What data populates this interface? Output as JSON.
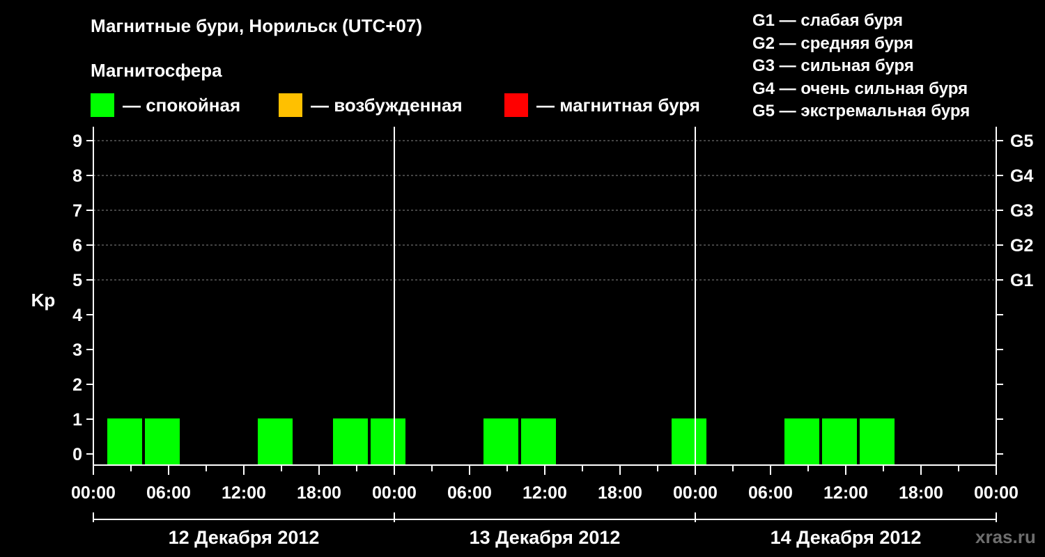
{
  "header": {
    "title": "Магнитные бури, Норильск (UTC+07)",
    "subtitle": "Магнитосфера"
  },
  "legend": [
    {
      "label": "— спокойная",
      "color": "#00ff00"
    },
    {
      "label": "— возбужденная",
      "color": "#ffc000"
    },
    {
      "label": "— магнитная буря",
      "color": "#ff0000"
    }
  ],
  "storm_scale": [
    "G1 — слабая буря",
    "G2 — средняя буря",
    "G3 — сильная буря",
    "G4 — очень сильная буря",
    "G5 — экстремальная буря"
  ],
  "watermark": "xras.ru",
  "colors": {
    "calm": "#00ff00",
    "disturbed": "#ffc000",
    "storm": "#ff0000",
    "background": "#000000",
    "axis": "#ffffff"
  },
  "chart_data": {
    "type": "bar",
    "ylabel": "Kp",
    "ylim": [
      0,
      9
    ],
    "y_ticks": [
      "0",
      "1",
      "2",
      "3",
      "4",
      "5",
      "6",
      "7",
      "8",
      "9"
    ],
    "right_ticks": [
      {
        "value": 5,
        "label": "G1"
      },
      {
        "value": 6,
        "label": "G2"
      },
      {
        "value": 7,
        "label": "G3"
      },
      {
        "value": 8,
        "label": "G4"
      },
      {
        "value": 9,
        "label": "G5"
      }
    ],
    "grid_lines_at": [
      5,
      6,
      7,
      8,
      9
    ],
    "x_ticks": [
      "00:00",
      "06:00",
      "12:00",
      "18:00",
      "00:00",
      "06:00",
      "12:00",
      "18:00",
      "00:00",
      "06:00",
      "12:00",
      "18:00",
      "00:00"
    ],
    "days": [
      "12 Декабря 2012",
      "13 Декабря 2012",
      "14 Декабря 2012"
    ],
    "bar_hours": 3,
    "bars": [
      {
        "start_hour": 1,
        "kp": 1,
        "level": "calm"
      },
      {
        "start_hour": 4,
        "kp": 1,
        "level": "calm"
      },
      {
        "start_hour": 13,
        "kp": 1,
        "level": "calm"
      },
      {
        "start_hour": 19,
        "kp": 1,
        "level": "calm"
      },
      {
        "start_hour": 22,
        "kp": 1,
        "level": "calm"
      },
      {
        "start_hour": 31,
        "kp": 1,
        "level": "calm"
      },
      {
        "start_hour": 34,
        "kp": 1,
        "level": "calm"
      },
      {
        "start_hour": 46,
        "kp": 1,
        "level": "calm"
      },
      {
        "start_hour": 55,
        "kp": 1,
        "level": "calm"
      },
      {
        "start_hour": 58,
        "kp": 1,
        "level": "calm"
      },
      {
        "start_hour": 61,
        "kp": 1,
        "level": "calm"
      }
    ]
  }
}
